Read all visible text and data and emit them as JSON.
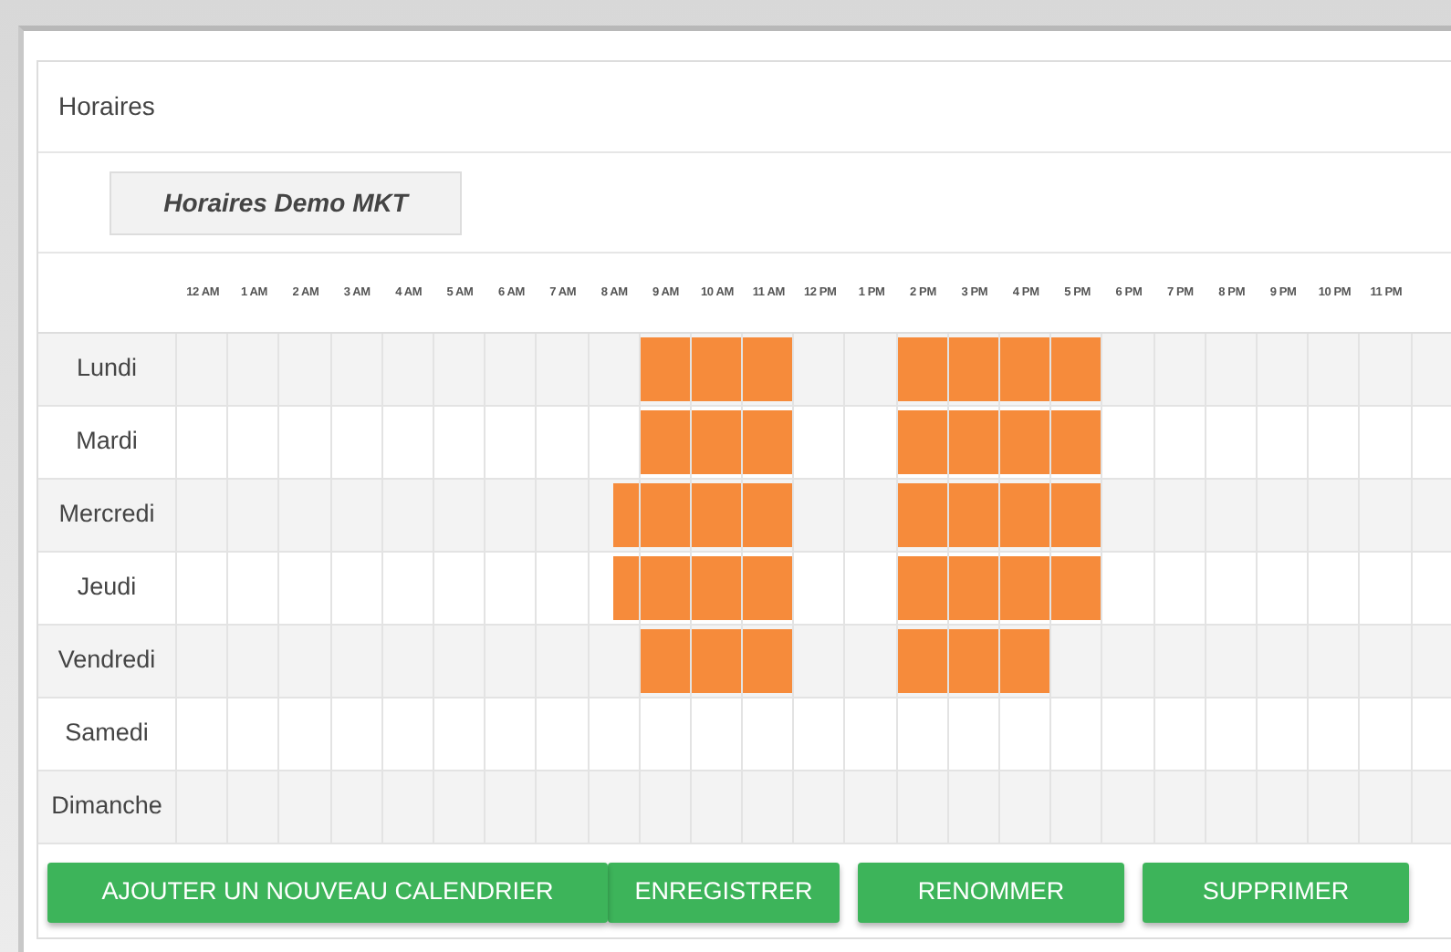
{
  "panel": {
    "title": "Horaires"
  },
  "calendar_tabs": [
    {
      "label": "Horaires Demo MKT",
      "selected": true
    }
  ],
  "hours": [
    "12 AM",
    "1 AM",
    "2 AM",
    "3 AM",
    "4 AM",
    "5 AM",
    "6 AM",
    "7 AM",
    "8 AM",
    "9 AM",
    "10 AM",
    "11 AM",
    "12 PM",
    "1 PM",
    "2 PM",
    "3 PM",
    "4 PM",
    "5 PM",
    "6 PM",
    "7 PM",
    "8 PM",
    "9 PM",
    "10 PM",
    "11 PM"
  ],
  "days": [
    {
      "name": "Lundi",
      "half_hours": [
        false,
        false,
        false,
        false,
        false,
        false,
        false,
        false,
        false,
        false,
        false,
        false,
        false,
        false,
        false,
        false,
        false,
        false,
        true,
        true,
        true,
        true,
        true,
        true,
        false,
        false,
        false,
        false,
        true,
        true,
        true,
        true,
        true,
        true,
        true,
        true,
        false,
        false,
        false,
        false,
        false,
        false,
        false,
        false,
        false,
        false,
        false,
        false
      ]
    },
    {
      "name": "Mardi",
      "half_hours": [
        false,
        false,
        false,
        false,
        false,
        false,
        false,
        false,
        false,
        false,
        false,
        false,
        false,
        false,
        false,
        false,
        false,
        false,
        true,
        true,
        true,
        true,
        true,
        true,
        false,
        false,
        false,
        false,
        true,
        true,
        true,
        true,
        true,
        true,
        true,
        true,
        false,
        false,
        false,
        false,
        false,
        false,
        false,
        false,
        false,
        false,
        false,
        false
      ]
    },
    {
      "name": "Mercredi",
      "half_hours": [
        false,
        false,
        false,
        false,
        false,
        false,
        false,
        false,
        false,
        false,
        false,
        false,
        false,
        false,
        false,
        false,
        false,
        true,
        true,
        true,
        true,
        true,
        true,
        true,
        false,
        false,
        false,
        false,
        true,
        true,
        true,
        true,
        true,
        true,
        true,
        true,
        false,
        false,
        false,
        false,
        false,
        false,
        false,
        false,
        false,
        false,
        false,
        false
      ]
    },
    {
      "name": "Jeudi",
      "half_hours": [
        false,
        false,
        false,
        false,
        false,
        false,
        false,
        false,
        false,
        false,
        false,
        false,
        false,
        false,
        false,
        false,
        false,
        true,
        true,
        true,
        true,
        true,
        true,
        true,
        false,
        false,
        false,
        false,
        true,
        true,
        true,
        true,
        true,
        true,
        true,
        true,
        false,
        false,
        false,
        false,
        false,
        false,
        false,
        false,
        false,
        false,
        false,
        false
      ]
    },
    {
      "name": "Vendredi",
      "half_hours": [
        false,
        false,
        false,
        false,
        false,
        false,
        false,
        false,
        false,
        false,
        false,
        false,
        false,
        false,
        false,
        false,
        false,
        false,
        true,
        true,
        true,
        true,
        true,
        true,
        false,
        false,
        false,
        false,
        true,
        true,
        true,
        true,
        true,
        true,
        false,
        false,
        false,
        false,
        false,
        false,
        false,
        false,
        false,
        false,
        false,
        false
      ]
    },
    {
      "name": "Samedi",
      "half_hours": [
        false,
        false,
        false,
        false,
        false,
        false,
        false,
        false,
        false,
        false,
        false,
        false,
        false,
        false,
        false,
        false,
        false,
        false,
        false,
        false,
        false,
        false,
        false,
        false,
        false,
        false,
        false,
        false,
        false,
        false,
        false,
        false,
        false,
        false,
        false,
        false,
        false,
        false,
        false,
        false,
        false,
        false,
        false,
        false,
        false,
        false,
        false,
        false
      ]
    },
    {
      "name": "Dimanche",
      "half_hours": [
        false,
        false,
        false,
        false,
        false,
        false,
        false,
        false,
        false,
        false,
        false,
        false,
        false,
        false,
        false,
        false,
        false,
        false,
        false,
        false,
        false,
        false,
        false,
        false,
        false,
        false,
        false,
        false,
        false,
        false,
        false,
        false,
        false,
        false,
        false,
        false,
        false,
        false,
        false,
        false,
        false,
        false,
        false,
        false,
        false,
        false,
        false,
        false
      ]
    }
  ],
  "buttons": [
    "AJOUTER UN NOUVEAU CALENDRIER",
    "ENREGISTRER",
    "RENOMMER",
    "SUPPRIMER"
  ]
}
